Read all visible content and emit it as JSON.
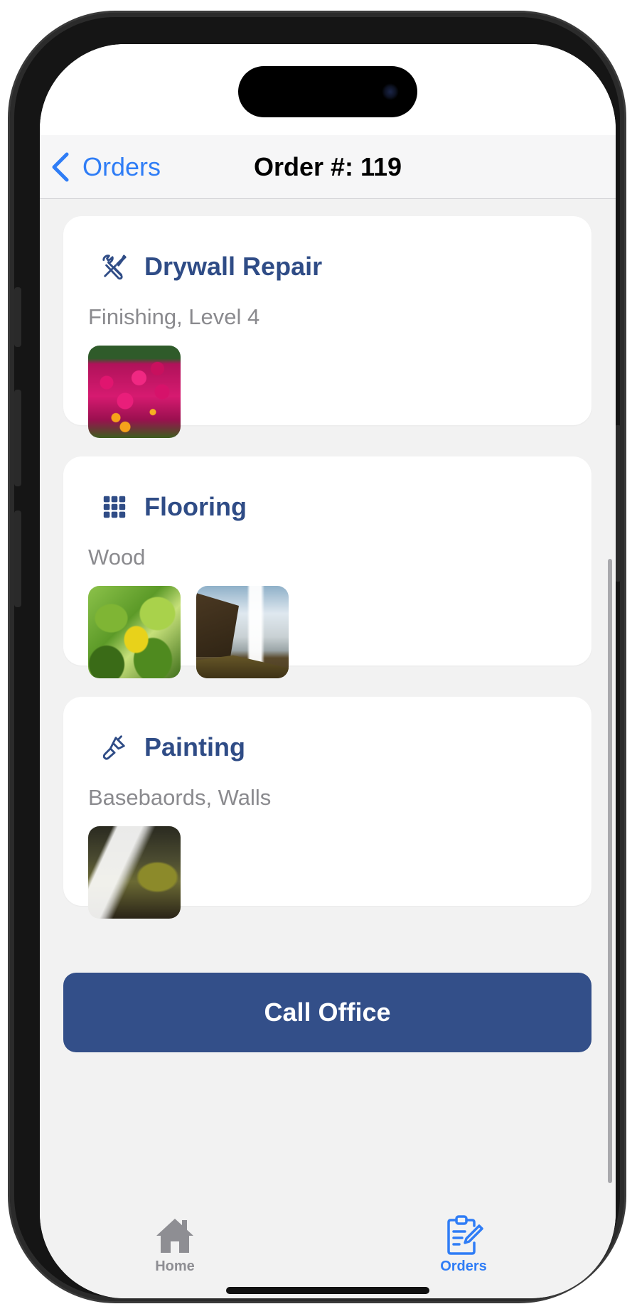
{
  "nav": {
    "back_label": "Orders",
    "title": "Order #: 119"
  },
  "cards": [
    {
      "icon": "wrench-screwdriver-icon",
      "title": "Drywall Repair",
      "subtitle": "Finishing, Level 4",
      "images": [
        "pink-flowers-photo"
      ]
    },
    {
      "icon": "grid-icon",
      "title": "Flooring",
      "subtitle": "Wood",
      "images": [
        "green-leaves-photo",
        "waterfall-cliff-photo"
      ]
    },
    {
      "icon": "paintbrush-icon",
      "title": "Painting",
      "subtitle": "Basebaords, Walls",
      "images": [
        "waterfall-rocks-photo"
      ]
    }
  ],
  "call_button": {
    "label": "Call Office"
  },
  "tabbar": {
    "items": [
      {
        "label": "Home",
        "icon": "house-icon",
        "active": false
      },
      {
        "label": "Orders",
        "icon": "clipboard-edit-icon",
        "active": true
      }
    ]
  },
  "colors": {
    "accent": "#2f7df6",
    "card_title": "#2f4c86",
    "button_bg": "#334f89",
    "subtitle": "#8a8a8e",
    "background": "#f2f2f2"
  }
}
